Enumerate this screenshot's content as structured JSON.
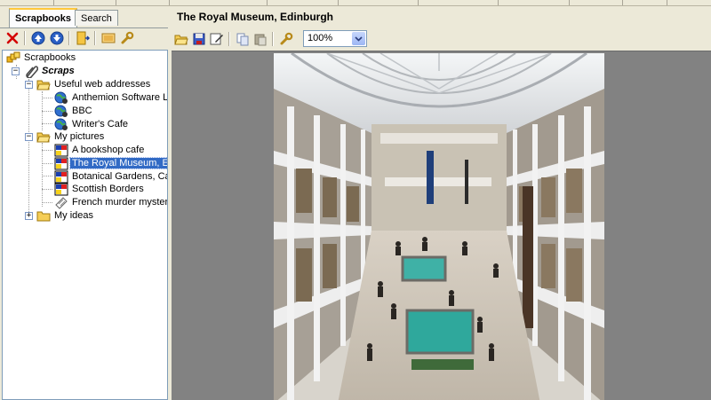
{
  "left_pane": {
    "tabs": [
      {
        "label": "Scrapbooks",
        "active": true
      },
      {
        "label": "Search",
        "active": false
      }
    ],
    "toolbar": {
      "delete_icon": "delete-x-icon",
      "up_icon": "move-up-icon",
      "down_icon": "move-down-icon",
      "new_folder_icon": "new-folder-icon",
      "picture_icon": "picture-icon",
      "properties_icon": "wrench-icon"
    },
    "tree": {
      "root": "Scrapbooks",
      "scraps": "Scraps",
      "folder_web": "Useful web addresses",
      "web_items": [
        "Anthemion Software Ltd",
        "BBC",
        "Writer's Cafe"
      ],
      "folder_pictures": "My pictures",
      "picture_items": [
        "A bookshop cafe",
        "The Royal Museum, Edinburgh",
        "Botanical Gardens, Cambridge",
        "Scottish Borders"
      ],
      "text_item": "French murder mystery",
      "folder_ideas": "My ideas",
      "selected": "The Royal Museum, Edinburgh"
    }
  },
  "right_pane": {
    "title": "The Royal Museum, Edinburgh",
    "zoom": "100%",
    "photo_subject": "museum-atrium-photo"
  },
  "colors": {
    "window_bg": "#ece9d8",
    "selection": "#316ac5",
    "viewer_bg": "#828282",
    "tab_highlight": "#ffc83c"
  }
}
